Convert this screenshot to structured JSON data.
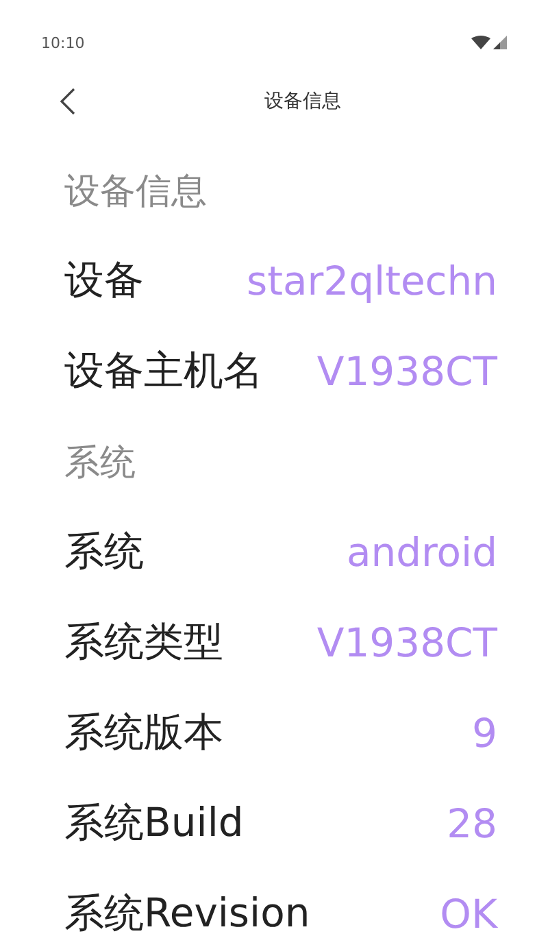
{
  "status_bar": {
    "time": "10:10"
  },
  "header": {
    "title": "设备信息"
  },
  "sections": [
    {
      "title": "设备信息",
      "rows": [
        {
          "label": "设备",
          "value": "star2qltechn"
        },
        {
          "label": "设备主机名",
          "value": "V1938CT"
        }
      ]
    },
    {
      "title": "系统",
      "rows": [
        {
          "label": "系统",
          "value": "android"
        },
        {
          "label": "系统类型",
          "value": "V1938CT"
        },
        {
          "label": "系统版本",
          "value": "9"
        },
        {
          "label": "系统Build",
          "value": "28"
        },
        {
          "label": "系统Revision",
          "value": "OK"
        }
      ]
    }
  ]
}
